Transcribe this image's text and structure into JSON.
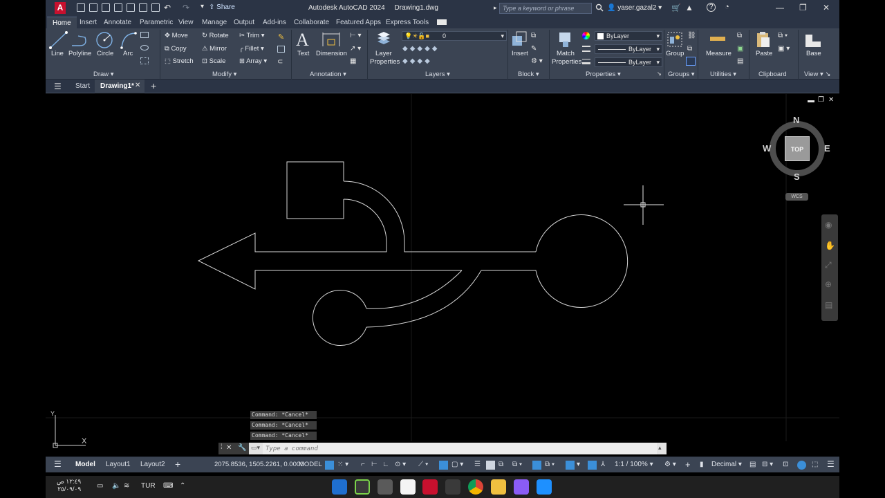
{
  "titlebar": {
    "app_name": "Autodesk AutoCAD 2024",
    "file_name": "Drawing1.dwg",
    "share_label": "Share",
    "search_placeholder": "Type a keyword or phrase",
    "user_name": "yaser.gazal2",
    "app_logo_letter": "A"
  },
  "ribbon_tabs": [
    "Home",
    "Insert",
    "Annotate",
    "Parametric",
    "View",
    "Manage",
    "Output",
    "Add-ins",
    "Collaborate",
    "Featured Apps",
    "Express Tools"
  ],
  "ribbon": {
    "draw": {
      "title": "Draw",
      "tools": [
        "Line",
        "Polyline",
        "Circle",
        "Arc"
      ]
    },
    "modify": {
      "title": "Modify",
      "tools": [
        "Move",
        "Rotate",
        "Trim",
        "Copy",
        "Mirror",
        "Fillet",
        "Stretch",
        "Scale",
        "Array"
      ]
    },
    "annotation": {
      "title": "Annotation",
      "tools": [
        "Text",
        "Dimension"
      ]
    },
    "layers": {
      "title": "Layers",
      "tool": "Layer Properties",
      "tool_line1": "Layer",
      "tool_line2": "Properties",
      "current_layer": "0"
    },
    "block": {
      "title": "Block",
      "tool": "Insert"
    },
    "properties": {
      "title": "Properties",
      "tool_line1": "Match",
      "tool_line2": "Properties",
      "color": "ByLayer",
      "linetype": "ByLayer",
      "lineweight": "ByLayer"
    },
    "groups": {
      "title": "Groups",
      "tool": "Group"
    },
    "utilities": {
      "title": "Utilities",
      "tool": "Measure"
    },
    "clipboard": {
      "title": "Clipboard",
      "tool": "Paste"
    },
    "view": {
      "title": "View",
      "tool": "Base"
    }
  },
  "doc_tabs": {
    "start": "Start",
    "drawing": "Drawing1*"
  },
  "viewcube": {
    "north": "N",
    "south": "S",
    "east": "E",
    "west": "W",
    "face": "TOP",
    "ucs": "WCS"
  },
  "ucs_icon": {
    "x": "X",
    "y": "Y"
  },
  "command": {
    "history": [
      "Command: *Cancel*",
      "Command: *Cancel*",
      "Command: *Cancel*"
    ],
    "placeholder": "Type a command"
  },
  "statusbar": {
    "model_tab": "Model",
    "layout1": "Layout1",
    "layout2": "Layout2",
    "coordinates": "2075.8536, 1505.2261, 0.0000",
    "space": "MODEL",
    "scale": "1:1 / 100%",
    "units": "Decimal"
  },
  "taskbar": {
    "time": "١٢:٤٩ ص",
    "date": "٢٥/٠٩/٠٩",
    "language": "TUR"
  },
  "colors": {
    "ribbon_bg": "#3b4453",
    "titlebar_bg": "#2b3445",
    "canvas_bg": "#000000",
    "accent_blue": "#3b8fd9",
    "autocad_red": "#c8102e"
  }
}
